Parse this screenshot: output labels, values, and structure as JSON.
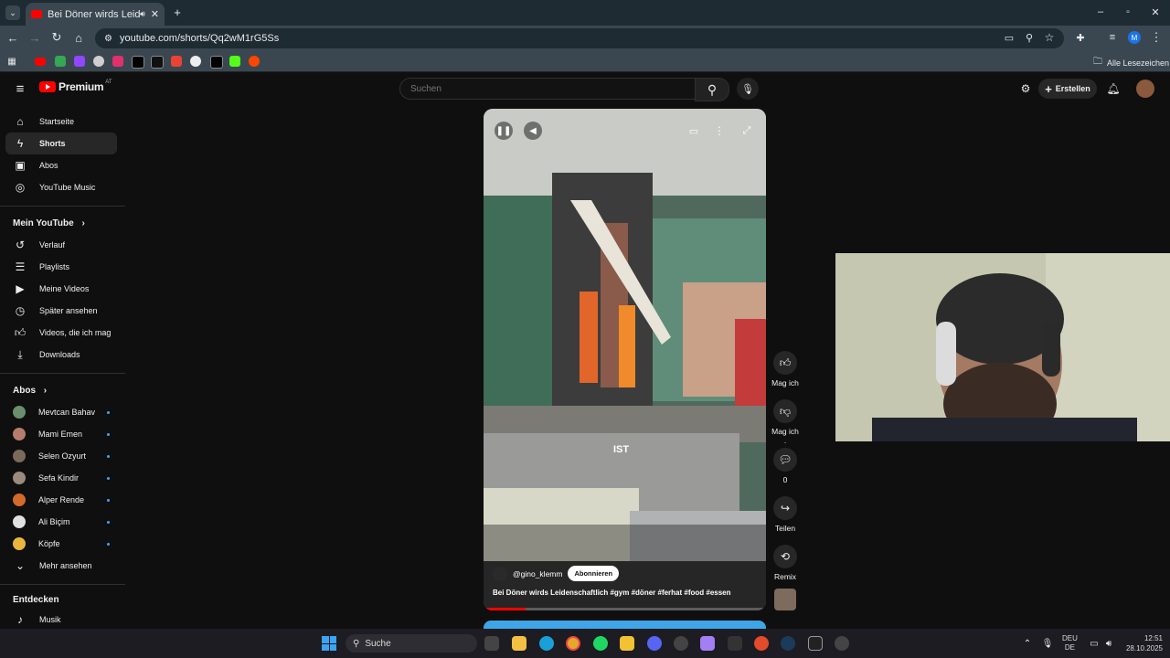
{
  "browser": {
    "tab_title": "Bei Döner wirds Leidenscha",
    "url": "youtube.com/shorts/Qq2wM1rG5Ss",
    "bookmarks_all": "Alle Lesezeichen",
    "profile_initial": "M"
  },
  "header": {
    "logo": "Premium",
    "region": "AT",
    "search_placeholder": "Suchen",
    "create_label": "Erstellen"
  },
  "sidebar": {
    "main": [
      {
        "label": "Startseite",
        "icon": "home-icon"
      },
      {
        "label": "Shorts",
        "icon": "shorts-icon"
      },
      {
        "label": "Abos",
        "icon": "subscriptions-icon"
      },
      {
        "label": "YouTube Music",
        "icon": "music-icon"
      }
    ],
    "you_heading": "Mein YouTube",
    "you": [
      {
        "label": "Verlauf",
        "icon": "history-icon"
      },
      {
        "label": "Playlists",
        "icon": "playlist-icon"
      },
      {
        "label": "Meine Videos",
        "icon": "video-icon"
      },
      {
        "label": "Später ansehen",
        "icon": "clock-icon"
      },
      {
        "label": "Videos, die ich mag",
        "icon": "like-icon"
      },
      {
        "label": "Downloads",
        "icon": "download-icon"
      }
    ],
    "subs_heading": "Abos",
    "subs": [
      {
        "label": "Mevtcan Bahav"
      },
      {
        "label": "Mami Emen"
      },
      {
        "label": "Selen Ozyurt"
      },
      {
        "label": "Sefa Kindir"
      },
      {
        "label": "Alper Rende"
      },
      {
        "label": "Ali Biçim"
      },
      {
        "label": "Köpfe"
      }
    ],
    "more": "Mehr ansehen",
    "explore_heading": "Entdecken",
    "explore": [
      {
        "label": "Musik"
      }
    ]
  },
  "short": {
    "overlay_text": "IST",
    "channel": "@gino_klemm",
    "subscribe": "Abonnieren",
    "caption": "Bei Döner wirds Leidenschaftlich #gym #döner #ferhat #food #essen",
    "actions": [
      {
        "label": "Mag ich",
        "icon": "thumb-up-icon"
      },
      {
        "label": "Mag ich .",
        "icon": "thumb-down-icon"
      },
      {
        "label": "0",
        "icon": "comment-icon"
      },
      {
        "label": "Teilen",
        "icon": "share-icon"
      },
      {
        "label": "Remix",
        "icon": "remix-icon"
      }
    ]
  },
  "taskbar": {
    "search": "Suche",
    "lang1": "DEU",
    "lang2": "DE",
    "time": "12:51",
    "date": "28.10.2025"
  },
  "colors": {
    "yt_red": "#ff0000",
    "chrome_dark": "#1f2b33",
    "chrome_mid": "#3a4750",
    "selected": "#272727"
  }
}
